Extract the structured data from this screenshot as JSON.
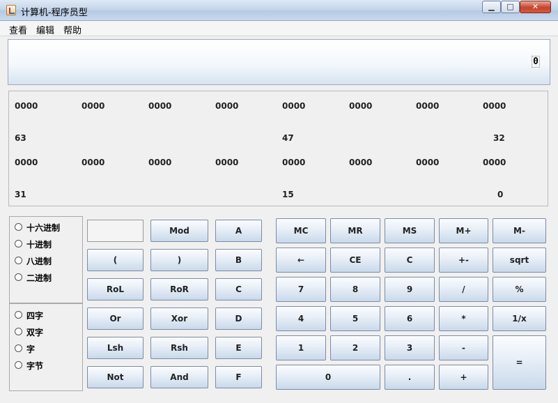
{
  "window": {
    "title": "计算机-程序员型",
    "minimize": "▁",
    "maximize": "□",
    "close": "✕",
    "icon": "java-icon"
  },
  "menu": [
    "查看",
    "编辑",
    "帮助"
  ],
  "display": {
    "value": "0"
  },
  "bits": {
    "row1": [
      "0000",
      "0000",
      "0000",
      "0000",
      "0000",
      "0000",
      "0000",
      "0000"
    ],
    "row1_marks": [
      "63",
      "47",
      "32"
    ],
    "row2": [
      "0000",
      "0000",
      "0000",
      "0000",
      "0000",
      "0000",
      "0000",
      "0000"
    ],
    "row2_marks": [
      "31",
      "15",
      "0"
    ]
  },
  "bases": [
    "十六进制",
    "十进制",
    "八进制",
    "二进制"
  ],
  "word_sizes": [
    "四字",
    "双字",
    "字",
    "字节"
  ],
  "buttons": {
    "mod": "Mod",
    "A": "A",
    "lparen": "(",
    "rparen": ")",
    "B": "B",
    "rol": "RoL",
    "ror": "RoR",
    "C": "C",
    "or": "Or",
    "xor": "Xor",
    "D": "D",
    "lsh": "Lsh",
    "rsh": "Rsh",
    "E": "E",
    "not": "Not",
    "and": "And",
    "F": "F",
    "mc": "MC",
    "mr": "MR",
    "ms": "MS",
    "mplus": "M+",
    "mminus": "M-",
    "back": "←",
    "ce": "CE",
    "clear": "C",
    "sign": "+-",
    "sqrt": "sqrt",
    "n7": "7",
    "n8": "8",
    "n9": "9",
    "div": "/",
    "pct": "%",
    "n4": "4",
    "n5": "5",
    "n6": "6",
    "mul": "*",
    "inv": "1/x",
    "n1": "1",
    "n2": "2",
    "n3": "3",
    "sub": "-",
    "eq": "=",
    "n0": "0",
    "dot": ".",
    "add": "+"
  }
}
